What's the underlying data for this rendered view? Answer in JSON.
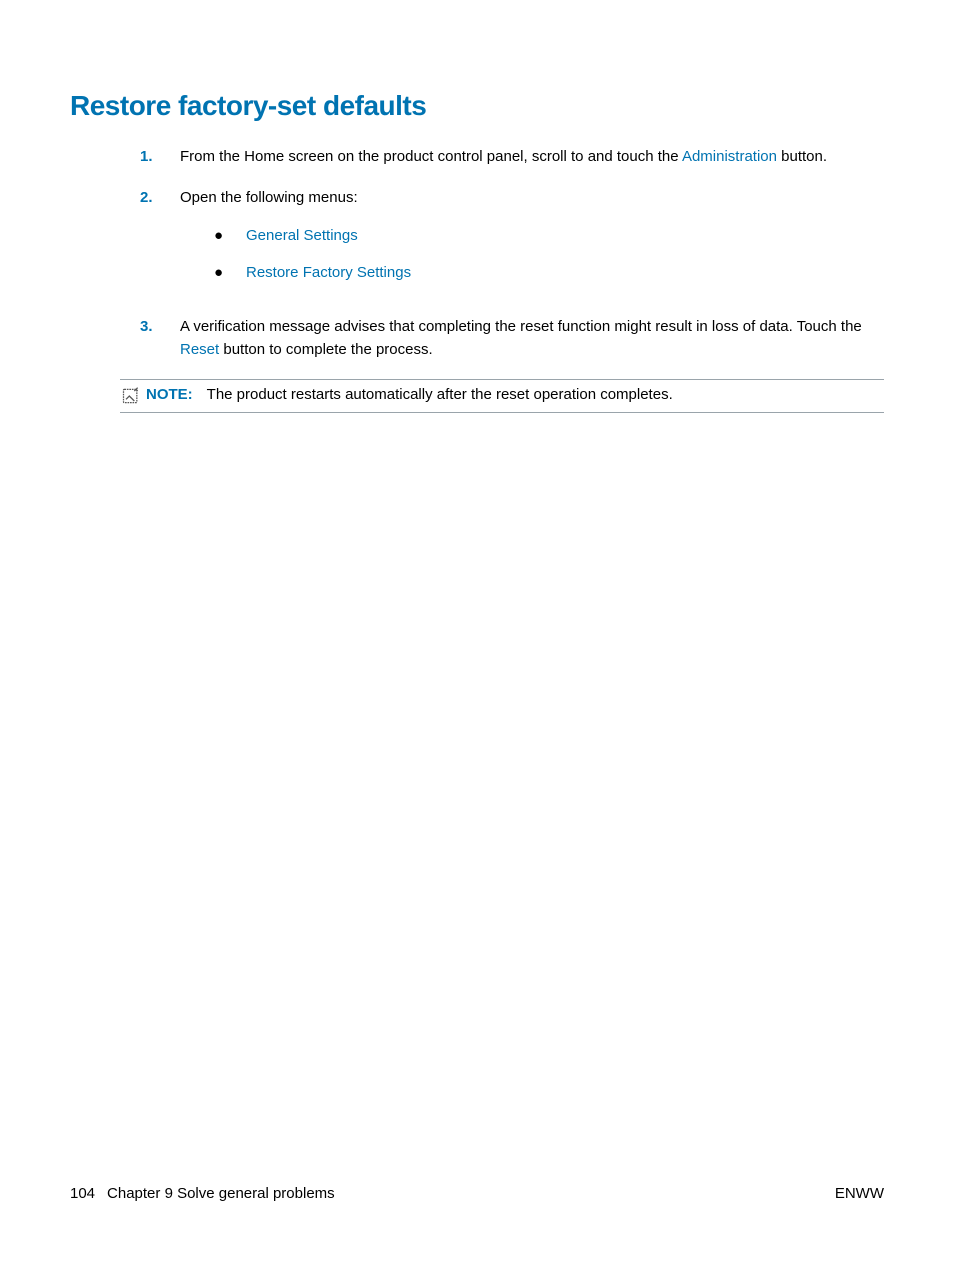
{
  "heading": "Restore factory-set defaults",
  "steps": [
    {
      "num": "1.",
      "pre": "From the Home screen on the product control panel, scroll to and touch the ",
      "link": "Administration",
      "post": " button."
    },
    {
      "num": "2.",
      "pre": "Open the following menus:",
      "bullets": [
        "General Settings",
        "Restore Factory Settings"
      ]
    },
    {
      "num": "3.",
      "pre": "A verification message advises that completing the reset function might result in loss of data. Touch the ",
      "link": "Reset",
      "post": " button to complete the process."
    }
  ],
  "note": {
    "label": "NOTE:",
    "text": "The product restarts automatically after the reset operation completes."
  },
  "footer": {
    "page": "104",
    "chapter": "Chapter 9   Solve general problems",
    "right": "ENWW"
  }
}
